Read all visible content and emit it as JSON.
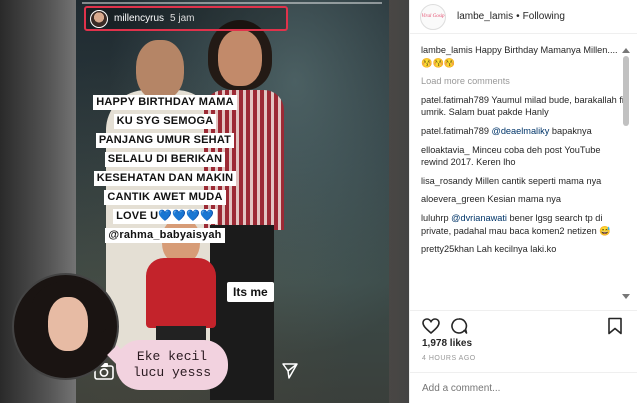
{
  "story": {
    "username": "millencyrus",
    "time": "5 jam",
    "caption_lines": [
      "HAPPY BIRTHDAY MAMA",
      "KU SYG SEMOGA",
      "PANJANG UMUR SEHAT",
      "SELALU DI BERIKAN",
      "KESEHATAN DAN MAKIN",
      "CANTIK AWET MUDA",
      "LOVE U💙💙💙💙",
      "@rahma_babyaisyah"
    ],
    "sticker": "Its me"
  },
  "bubble": {
    "line1": "Eke kecil",
    "line2": "lucu yesss"
  },
  "post": {
    "username": "lambe_lamis",
    "separator": "•",
    "following": "Following",
    "avatar_text": "Viral Gosip"
  },
  "comments": {
    "caption_user": "lambe_lamis",
    "caption_text": " Happy Birthday Mamanya Millen.... 😚😚😚",
    "load_more": "Load more comments",
    "items": [
      {
        "user": "patel.fatimah789",
        "text": " Yaumul milad bude, barakallah fii umrik. Salam buat pakde Hanly",
        "mention": ""
      },
      {
        "user": "patel.fatimah789",
        "text": " bapaknya",
        "mention": " @deaelmaliky"
      },
      {
        "user": "elloaktavia_",
        "text": " Minceu coba deh post YouTube rewind 2017. Keren lho",
        "mention": ""
      },
      {
        "user": "lisa_rosandy",
        "text": " Millen cantik seperti mama nya",
        "mention": ""
      },
      {
        "user": "aloevera_green",
        "text": " Kesian mama nya",
        "mention": ""
      },
      {
        "user": "luluhrp",
        "text": " bener lgsg search tp di private, padahal mau baca komen2 netizen 😅",
        "mention": " @dvrianawati"
      },
      {
        "user": "pretty25khan",
        "text": " Lah kecilnya laki.ko",
        "mention": ""
      }
    ]
  },
  "likes": "1,978 likes",
  "time_ago": "4 HOURS AGO",
  "add_comment_placeholder": "Add a comment...",
  "colors": {
    "story_highlight_border": "#e0324b",
    "bubble_bg": "#f2d2df",
    "mention": "#003569"
  },
  "icons": [
    "camera-icon",
    "send-icon",
    "heart-icon",
    "comment-icon",
    "bookmark-icon"
  ]
}
